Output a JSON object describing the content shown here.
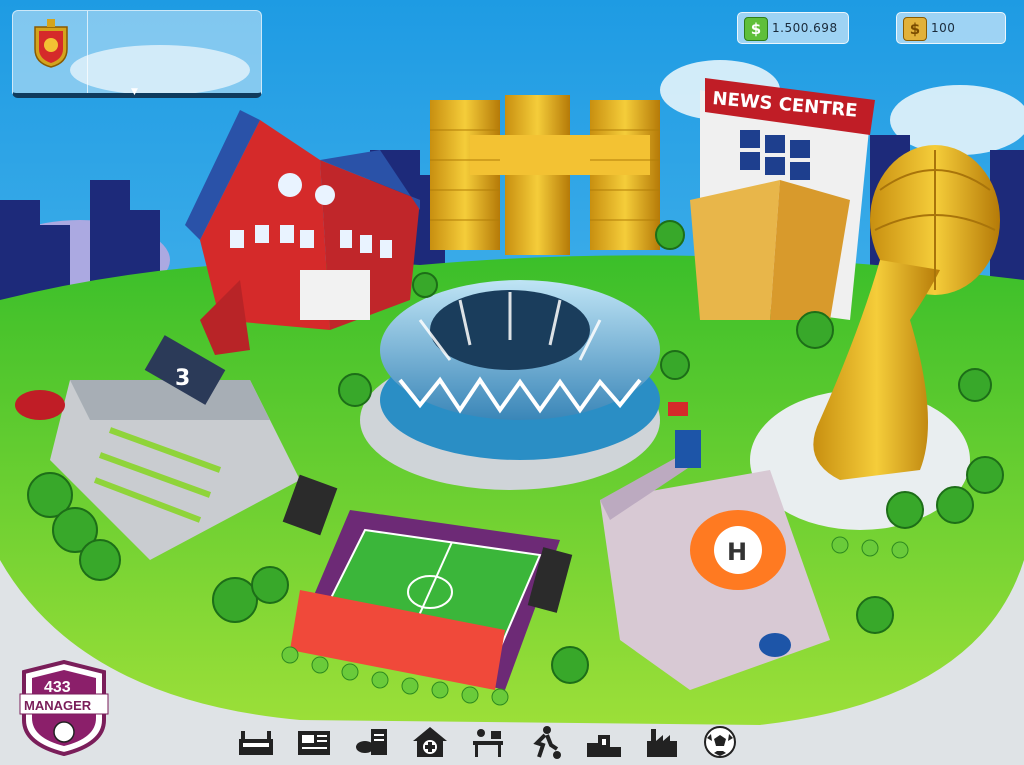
{
  "header": {
    "balance": "1.500.698",
    "coins": "100"
  },
  "buildings": {
    "news_centre_sign": "NEWS CENTRE",
    "training_number": "3",
    "hospital_letter": "H"
  },
  "logo": {
    "number": "433",
    "word": "MANAGER"
  },
  "icons": {
    "cash": "$",
    "coin": "$"
  },
  "toolbar": {
    "items": [
      {
        "name": "stadium-icon"
      },
      {
        "name": "newspaper-icon"
      },
      {
        "name": "whistle-contract-icon"
      },
      {
        "name": "medical-house-icon"
      },
      {
        "name": "office-desk-icon"
      },
      {
        "name": "training-player-icon"
      },
      {
        "name": "podium-icon"
      },
      {
        "name": "factory-icon"
      },
      {
        "name": "football-icon"
      }
    ]
  }
}
